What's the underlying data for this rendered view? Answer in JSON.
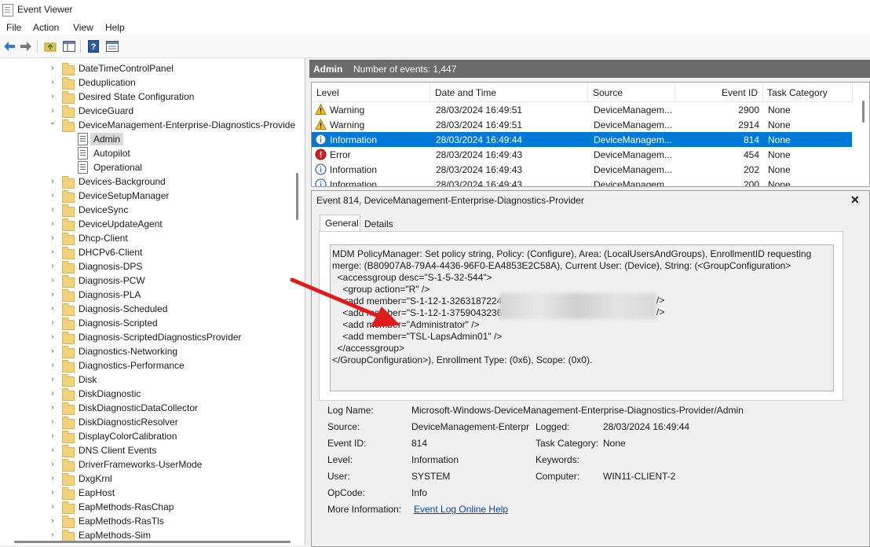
{
  "window": {
    "title": "Event Viewer"
  },
  "menu": [
    "File",
    "Action",
    "View",
    "Help"
  ],
  "toolbar": {
    "icons": [
      "back-icon",
      "forward-icon",
      "up-folder-icon",
      "show-hide-tree-icon",
      "help-icon",
      "properties-icon"
    ]
  },
  "tree": {
    "items": [
      {
        "label": "DateTimeControlPanel",
        "type": "folder",
        "expand": "collapsed"
      },
      {
        "label": "Deduplication",
        "type": "folder",
        "expand": "collapsed"
      },
      {
        "label": "Desired State Configuration",
        "type": "folder",
        "expand": "collapsed"
      },
      {
        "label": "DeviceGuard",
        "type": "folder",
        "expand": "collapsed"
      },
      {
        "label": "DeviceManagement-Enterprise-Diagnostics-Provide",
        "type": "folder",
        "expand": "expanded"
      },
      {
        "label": "Admin",
        "type": "log",
        "selected": true
      },
      {
        "label": "Autopilot",
        "type": "log"
      },
      {
        "label": "Operational",
        "type": "log"
      },
      {
        "label": "Devices-Background",
        "type": "folder",
        "expand": "collapsed"
      },
      {
        "label": "DeviceSetupManager",
        "type": "folder",
        "expand": "collapsed"
      },
      {
        "label": "DeviceSync",
        "type": "folder",
        "expand": "collapsed"
      },
      {
        "label": "DeviceUpdateAgent",
        "type": "folder",
        "expand": "collapsed"
      },
      {
        "label": "Dhcp-Client",
        "type": "folder",
        "expand": "collapsed"
      },
      {
        "label": "DHCPv6-Client",
        "type": "folder",
        "expand": "collapsed"
      },
      {
        "label": "Diagnosis-DPS",
        "type": "folder",
        "expand": "collapsed"
      },
      {
        "label": "Diagnosis-PCW",
        "type": "folder",
        "expand": "collapsed"
      },
      {
        "label": "Diagnosis-PLA",
        "type": "folder",
        "expand": "collapsed"
      },
      {
        "label": "Diagnosis-Scheduled",
        "type": "folder",
        "expand": "collapsed"
      },
      {
        "label": "Diagnosis-Scripted",
        "type": "folder",
        "expand": "collapsed"
      },
      {
        "label": "Diagnosis-ScriptedDiagnosticsProvider",
        "type": "folder",
        "expand": "collapsed"
      },
      {
        "label": "Diagnostics-Networking",
        "type": "folder",
        "expand": "collapsed"
      },
      {
        "label": "Diagnostics-Performance",
        "type": "folder",
        "expand": "collapsed"
      },
      {
        "label": "Disk",
        "type": "folder",
        "expand": "collapsed"
      },
      {
        "label": "DiskDiagnostic",
        "type": "folder",
        "expand": "collapsed"
      },
      {
        "label": "DiskDiagnosticDataCollector",
        "type": "folder",
        "expand": "collapsed"
      },
      {
        "label": "DiskDiagnosticResolver",
        "type": "folder",
        "expand": "collapsed"
      },
      {
        "label": "DisplayColorCalibration",
        "type": "folder",
        "expand": "collapsed"
      },
      {
        "label": "DNS Client Events",
        "type": "folder",
        "expand": "collapsed"
      },
      {
        "label": "DriverFrameworks-UserMode",
        "type": "folder",
        "expand": "collapsed"
      },
      {
        "label": "DxgKrnl",
        "type": "folder",
        "expand": "collapsed"
      },
      {
        "label": "EapHost",
        "type": "folder",
        "expand": "collapsed"
      },
      {
        "label": "EapMethods-RasChap",
        "type": "folder",
        "expand": "collapsed"
      },
      {
        "label": "EapMethods-RasTls",
        "type": "folder",
        "expand": "collapsed"
      },
      {
        "label": "EapMethods-Sim",
        "type": "folder",
        "expand": "collapsed"
      }
    ]
  },
  "header": {
    "log_name": "Admin",
    "count_text": "Number of events: 1,447"
  },
  "table": {
    "columns": [
      "Level",
      "Date and Time",
      "Source",
      "Event ID",
      "Task Category"
    ],
    "rows": [
      {
        "level": "Warning",
        "icon": "warning-icon",
        "datetime": "28/03/2024 16:49:51",
        "source": "DeviceManagem...",
        "event_id": "2900",
        "task": "None",
        "selected": false
      },
      {
        "level": "Warning",
        "icon": "warning-icon",
        "datetime": "28/03/2024 16:49:51",
        "source": "DeviceManagem...",
        "event_id": "2914",
        "task": "None",
        "selected": false
      },
      {
        "level": "Information",
        "icon": "info-icon",
        "datetime": "28/03/2024 16:49:44",
        "source": "DeviceManagem...",
        "event_id": "814",
        "task": "None",
        "selected": true
      },
      {
        "level": "Error",
        "icon": "error-icon",
        "datetime": "28/03/2024 16:49:43",
        "source": "DeviceManagem...",
        "event_id": "454",
        "task": "None",
        "selected": false
      },
      {
        "level": "Information",
        "icon": "info-icon",
        "datetime": "28/03/2024 16:49:43",
        "source": "DeviceManagem...",
        "event_id": "202",
        "task": "None",
        "selected": false
      },
      {
        "level": "Information",
        "icon": "info-icon",
        "datetime": "28/03/2024 16:49:43",
        "source": "DeviceManagem...",
        "event_id": "200",
        "task": "None",
        "selected": false
      }
    ]
  },
  "detail": {
    "title": "Event 814, DeviceManagement-Enterprise-Diagnostics-Provider",
    "tabs": [
      "General",
      "Details"
    ],
    "message_lines": [
      "MDM PolicyManager: Set policy string, Policy: (Configure), Area: (LocalUsersAndGroups), EnrollmentID requesting",
      "merge: (B80907A8-79A4-4436-96F0-EA4853E2C58A), Current User: (Device), String: (<GroupConfiguration>",
      "  <accessgroup desc=\"S-1-5-32-544\">",
      "    <group action=\"R\" />",
      "    <add member=\"S-1-12-1-3263187224-",
      "    <add member=\"S-1-12-1-3759043236-",
      "    <add member=\"Administrator\" />",
      "    <add member=\"TSL-LapsAdmin01\" />",
      "  </accessgroup>",
      "</GroupConfiguration>), Enrollment Type: (0x6), Scope: (0x0)."
    ],
    "message_tail": "/>",
    "fields": {
      "log_name_label": "Log Name:",
      "log_name": "Microsoft-Windows-DeviceManagement-Enterprise-Diagnostics-Provider/Admin",
      "source_label": "Source:",
      "source": "DeviceManagement-Enterpr",
      "logged_label": "Logged:",
      "logged": "28/03/2024 16:49:44",
      "event_id_label": "Event ID:",
      "event_id": "814",
      "task_label": "Task Category:",
      "task": "None",
      "level_label": "Level:",
      "level": "Information",
      "keywords_label": "Keywords:",
      "keywords": "",
      "user_label": "User:",
      "user": "SYSTEM",
      "computer_label": "Computer:",
      "computer": "WIN11-CLIENT-2",
      "opcode_label": "OpCode:",
      "opcode": "Info",
      "more_info_label": "More Information:",
      "more_info_link": "Event Log Online Help"
    }
  },
  "colors": {
    "selection": "#0078d7",
    "header_bar": "#6b6b6b",
    "annotation_arrow": "#e01b1b",
    "link": "#0645ad"
  }
}
